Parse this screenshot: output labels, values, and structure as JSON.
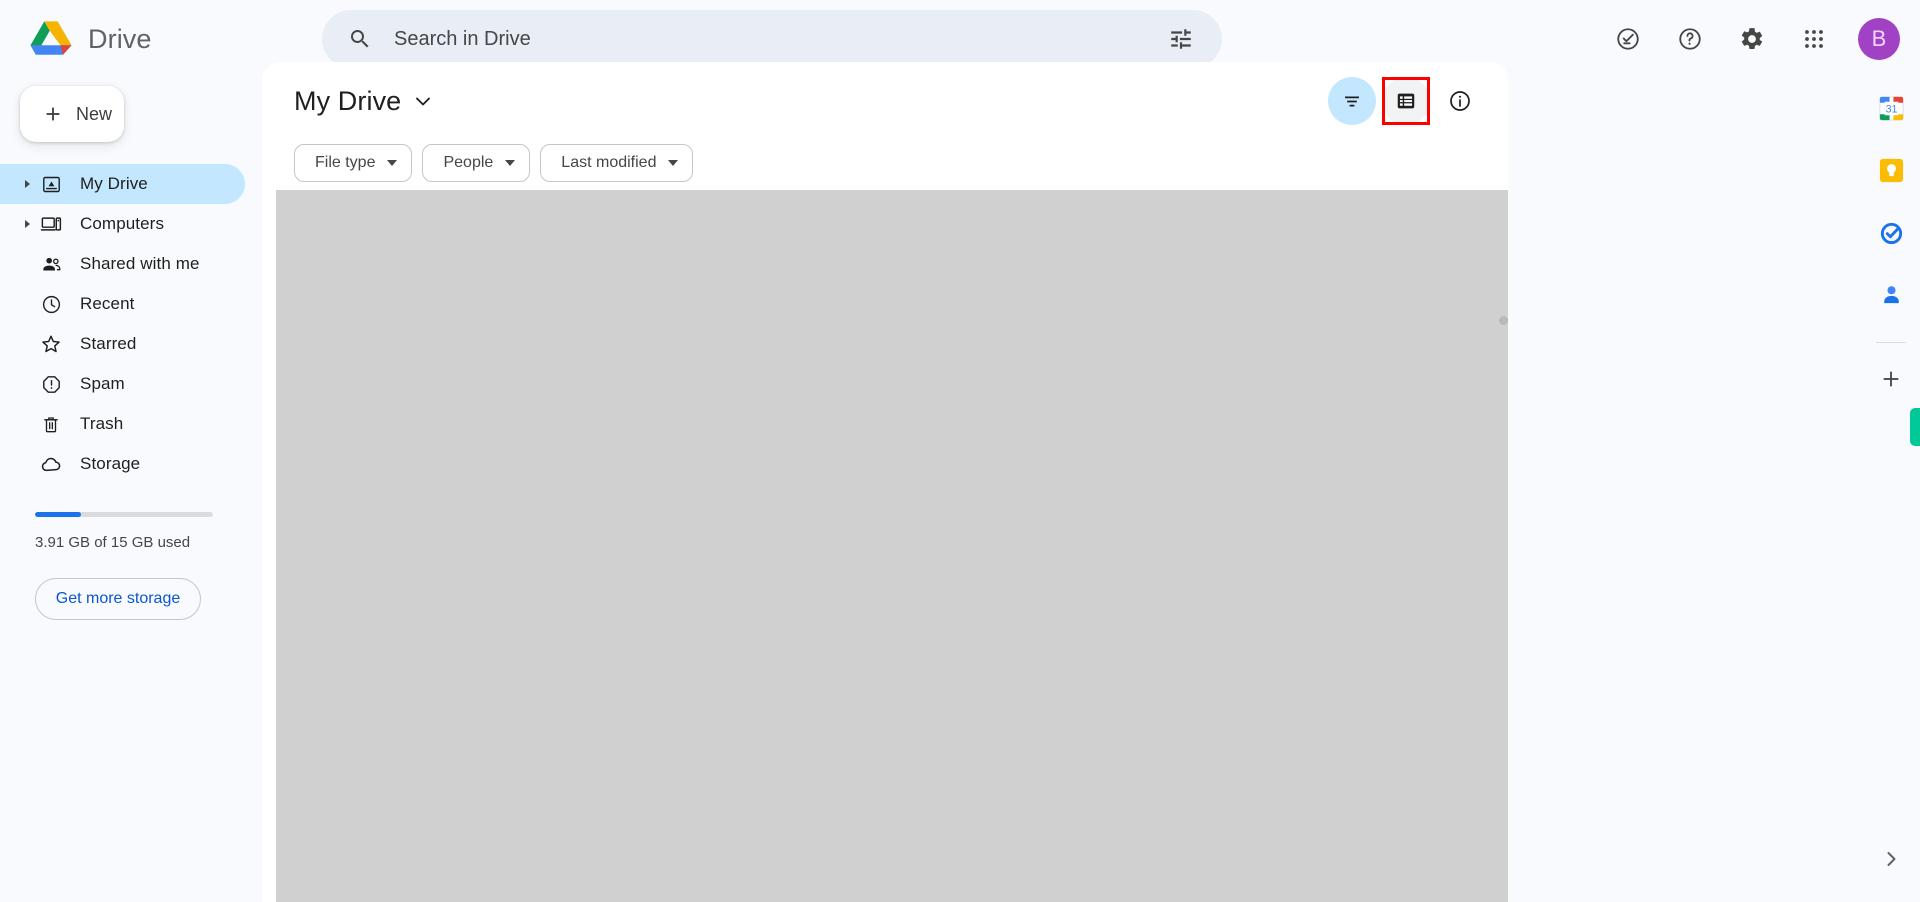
{
  "app": {
    "brand_name": "Drive",
    "logo_icon": "google-drive-logo"
  },
  "search": {
    "placeholder": "Search in Drive",
    "value": "",
    "search_icon": "search-icon",
    "tune_icon": "tune-filter-icon"
  },
  "top_actions": [
    {
      "name": "task-status-icon",
      "label": "Support / status"
    },
    {
      "name": "help-icon",
      "label": "Help"
    },
    {
      "name": "settings-gear-icon",
      "label": "Settings"
    },
    {
      "name": "google-apps-grid-icon",
      "label": "Google apps"
    }
  ],
  "account": {
    "avatar_initial": "B",
    "avatar_bg": "#a142c4",
    "avatar_fg": "#f3d7fb"
  },
  "sidebar": {
    "new_button": {
      "label": "New",
      "icon": "plus-icon"
    },
    "items": [
      {
        "label": "My Drive",
        "icon": "my-drive-icon",
        "expandable": true,
        "active": true
      },
      {
        "label": "Computers",
        "icon": "computers-icon",
        "expandable": true,
        "active": false
      },
      {
        "label": "Shared with me",
        "icon": "shared-with-me-icon",
        "expandable": false,
        "active": false
      },
      {
        "label": "Recent",
        "icon": "clock-icon",
        "expandable": false,
        "active": false
      },
      {
        "label": "Starred",
        "icon": "star-icon",
        "expandable": false,
        "active": false
      },
      {
        "label": "Spam",
        "icon": "spam-icon",
        "expandable": false,
        "active": false
      },
      {
        "label": "Trash",
        "icon": "trash-icon",
        "expandable": false,
        "active": false
      },
      {
        "label": "Storage",
        "icon": "cloud-icon",
        "expandable": false,
        "active": false
      }
    ],
    "storage": {
      "used_text": "3.91 GB of 15 GB used",
      "percent": 26,
      "bar_color": "#1a73e8",
      "cta_label": "Get more storage"
    }
  },
  "main": {
    "title": "My Drive",
    "title_caret_icon": "chevron-down-icon",
    "actions": [
      {
        "name": "sort-filter-button",
        "icon": "sort-icon",
        "tinted": true,
        "highlighted": false
      },
      {
        "name": "list-view-button",
        "icon": "list-view-icon",
        "tinted": false,
        "highlighted": true
      },
      {
        "name": "details-info-button",
        "icon": "info-circle-icon",
        "tinted": false,
        "highlighted": false
      }
    ],
    "chips": [
      {
        "label": "File type",
        "caret_icon": "chevron-down-icon"
      },
      {
        "label": "People",
        "caret_icon": "chevron-down-icon"
      },
      {
        "label": "Last modified",
        "caret_icon": "chevron-down-icon"
      }
    ]
  },
  "rightbar": {
    "apps": [
      {
        "name": "google-calendar-icon",
        "label": "Calendar",
        "day": "31"
      },
      {
        "name": "google-keep-icon",
        "label": "Keep"
      },
      {
        "name": "google-tasks-icon",
        "label": "Tasks"
      },
      {
        "name": "google-contacts-icon",
        "label": "Contacts"
      }
    ],
    "add_button": {
      "name": "add-app-icon",
      "label": "Get add-ons"
    },
    "expand_button": {
      "name": "expand-panel-chevron-icon",
      "label": "Show side panel"
    },
    "green_tab_color": "#00c896"
  },
  "highlight": {
    "color": "#ff0000",
    "target": "list-view-button"
  }
}
